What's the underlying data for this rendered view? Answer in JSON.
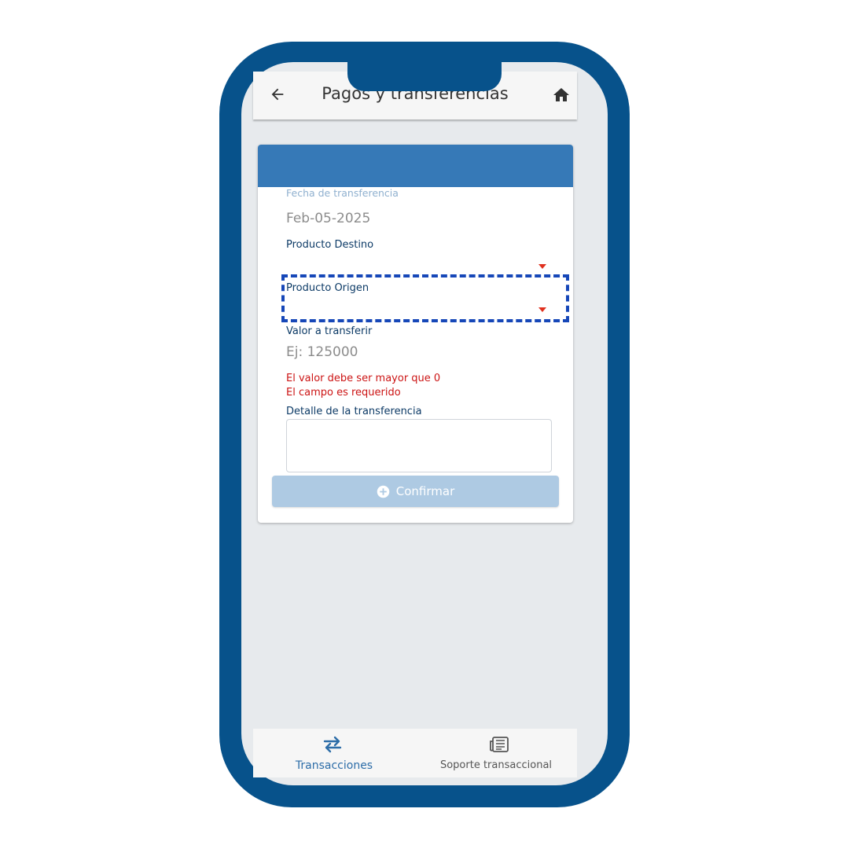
{
  "header": {
    "title": "Pagos y transferencias"
  },
  "form": {
    "date_label": "Fecha de transferencia",
    "date_value": "Feb-05-2025",
    "destination_label": "Producto Destino",
    "origin_label": "Producto Origen",
    "amount_label": "Valor a transferir",
    "amount_placeholder": "Ej: 125000",
    "errors": [
      "El valor debe ser mayor que 0",
      "El campo es requerido"
    ],
    "detail_label": "Detalle de la transferencia",
    "confirm_label": "Confirmar"
  },
  "bottom_nav": {
    "items": [
      {
        "label": "Transacciones",
        "icon": "swap-arrows-icon",
        "active": true
      },
      {
        "label": "Soporte transaccional",
        "icon": "newspaper-icon",
        "active": false
      }
    ]
  },
  "colors": {
    "phone_frame": "#07528b",
    "card_header": "#3679b7",
    "accent": "#2d6da8",
    "error": "#cc1414",
    "highlight": "#1647b8",
    "disabled_button": "#aecae3"
  }
}
